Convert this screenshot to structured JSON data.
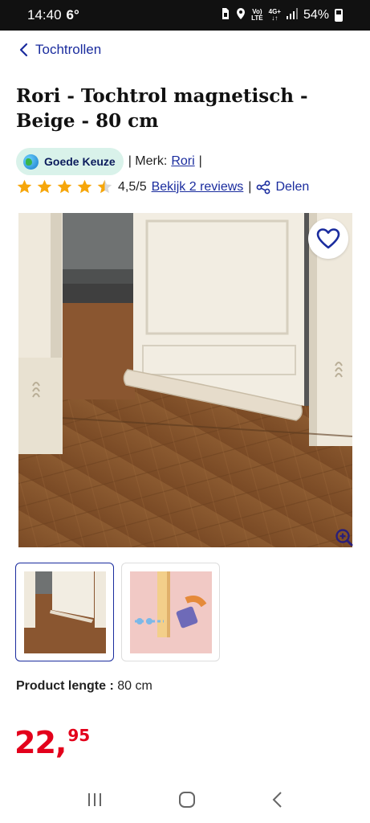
{
  "status_bar": {
    "time": "14:40",
    "temp": "6°",
    "battery": "54%",
    "net_top": "Vo)",
    "net_bottom": "LTE",
    "gen_top": "4G+",
    "gen_bottom": "↓↑"
  },
  "nav": {
    "back_label": "Tochtrollen"
  },
  "product": {
    "title": "Rori - Tochtrol magnetisch - Beige - 80 cm",
    "badge_label": "Goede Keuze",
    "brand_prefix": "| Merk:",
    "brand_name": "Rori",
    "brand_suffix": "|",
    "rating_value": 4.5,
    "rating_text": "4,5/5",
    "reviews_link": "Bekijk 2 reviews",
    "share_sep": "|",
    "share_label": "Delen",
    "spec_label": "Product lengte :",
    "spec_value": "80 cm",
    "price_int": "22",
    "price_comma": ",",
    "price_dec": "95"
  },
  "colors": {
    "accent_blue": "#1a2c9e",
    "price_red": "#e3001b",
    "badge_bg": "#d9f2ea",
    "star": "#f6a60a"
  },
  "icons": {
    "back": "chevron-left-icon",
    "globe": "globe-icon",
    "share": "share-icon",
    "favorite": "heart-icon",
    "zoom": "zoom-in-icon"
  }
}
